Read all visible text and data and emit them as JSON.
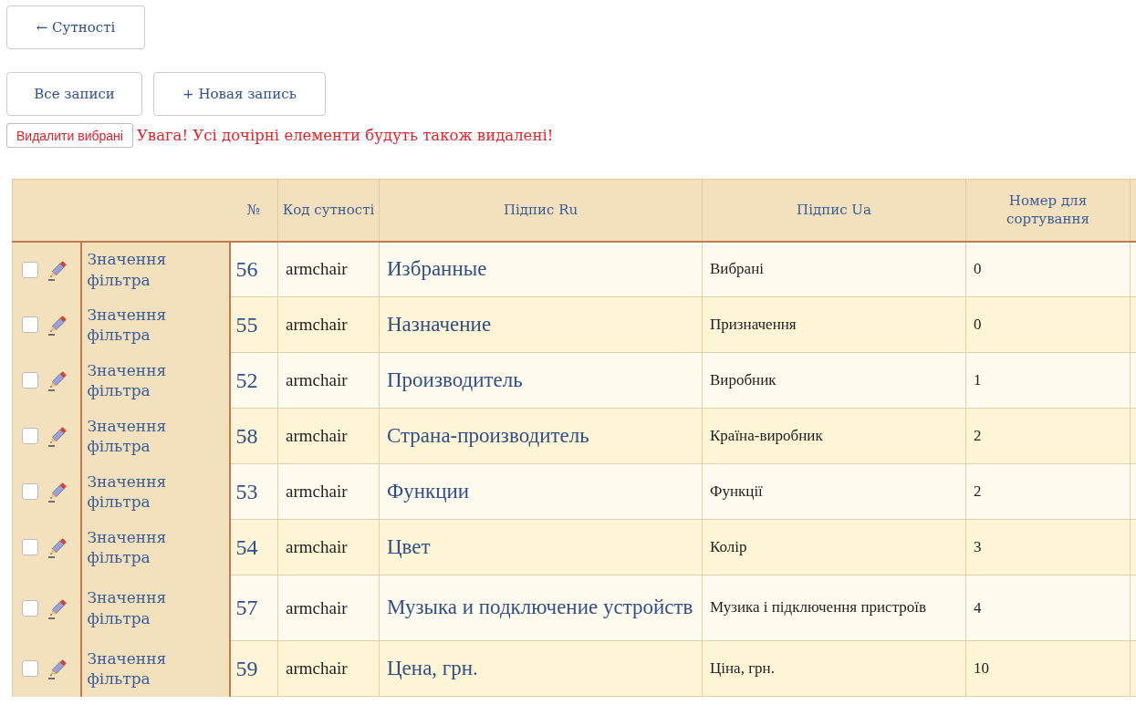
{
  "back_button": "← Сутності",
  "actions": [
    "Все записи",
    "+ Новая запись"
  ],
  "delete_button": "Видалити вибрані",
  "warning": "Увага! Усі дочірні елементи будуть також видалені!",
  "table": {
    "columns": [
      "№",
      "Код сутності",
      "Підпис Ru",
      "Підпис Ua",
      "Номер для сортування"
    ],
    "rows": [
      {
        "checked": false,
        "type": "Значення фільтра",
        "number": "56",
        "code": "armchair",
        "label_ru": "Избранные",
        "label_ua": "Вибрані",
        "sort": "0"
      },
      {
        "checked": false,
        "type": "Значення фільтра",
        "number": "55",
        "code": "armchair",
        "label_ru": "Назначение",
        "label_ua": "Призначення",
        "sort": "0"
      },
      {
        "checked": false,
        "type": "Значення фільтра",
        "number": "52",
        "code": "armchair",
        "label_ru": "Производитель",
        "label_ua": "Виробник",
        "sort": "1"
      },
      {
        "checked": false,
        "type": "Значення фільтра",
        "number": "58",
        "code": "armchair",
        "label_ru": "Страна-производитель",
        "label_ua": "Країна-виробник",
        "sort": "2"
      },
      {
        "checked": false,
        "type": "Значення фільтра",
        "number": "53",
        "code": "armchair",
        "label_ru": "Функции",
        "label_ua": "Функції",
        "sort": "2"
      },
      {
        "checked": false,
        "type": "Значення фільтра",
        "number": "54",
        "code": "armchair",
        "label_ru": "Цвет",
        "label_ua": "Колір",
        "sort": "3"
      },
      {
        "checked": false,
        "type": "Значення фільтра",
        "number": "57",
        "code": "armchair",
        "label_ru": "Музыка и подключение устройств",
        "label_ua": "Музика і підключення пристроїв",
        "sort": "4"
      },
      {
        "checked": false,
        "type": "Значення фільтра",
        "number": "59",
        "code": "armchair",
        "label_ru": "Цена, грн.",
        "label_ua": "Ціна, грн.",
        "sort": "10"
      }
    ]
  }
}
